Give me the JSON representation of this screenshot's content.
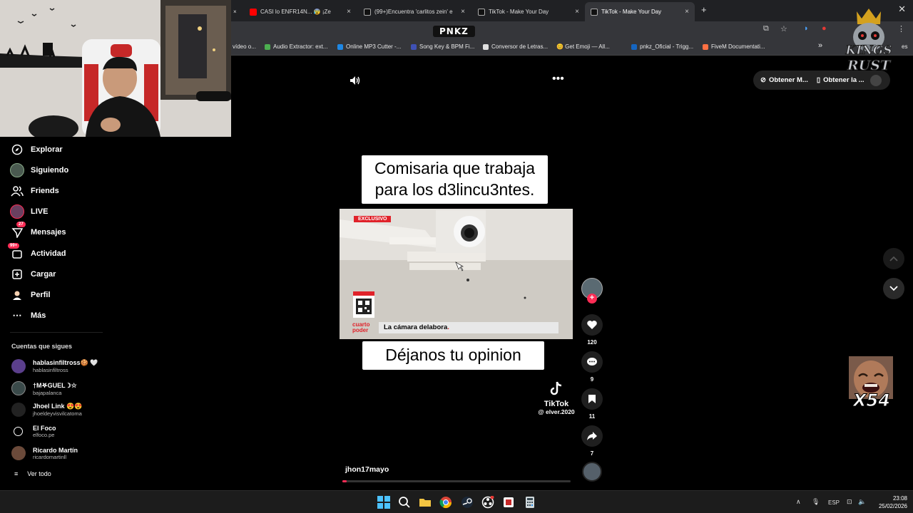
{
  "browser": {
    "tabs": [
      {
        "title": "CASI lo ENFR14N... 😰 ¡Ze",
        "favicon_color": "#ff0000"
      },
      {
        "title": "(99+)Encuentra 'carlitos zein' e",
        "favicon_color": "#222222"
      },
      {
        "title": "TikTok - Make Your Day",
        "favicon_color": "#222222"
      },
      {
        "title": "TikTok - Make Your Day",
        "favicon_color": "#222222"
      }
    ],
    "active_tab_index": 3,
    "tab_close_glyph": "×",
    "new_tab_glyph": "+",
    "window_close_glyph": "✕",
    "logo_text": "PNKZ",
    "bookmarks": [
      {
        "label": "vídeo o...",
        "color": "#888888"
      },
      {
        "label": "Audio Extractor: ext...",
        "color": "#4caf50"
      },
      {
        "label": "Online MP3 Cutter -...",
        "color": "#1e88e5"
      },
      {
        "label": "Song Key & BPM Fi...",
        "color": "#3f51b5"
      },
      {
        "label": "Conversor de Letras...",
        "color": "#e0e0e0"
      },
      {
        "label": "😊 Get Emoji — All...",
        "color": "#f4b400"
      },
      {
        "label": "pnkz_Oficial - Trigg...",
        "color": "#1565c0"
      },
      {
        "label": "FiveM Documentati...",
        "color": "#ff7043"
      }
    ],
    "bookmarks_overflow": "»",
    "bookmarks_tail": "es"
  },
  "sidebar": {
    "nav": [
      {
        "label": "Explorar",
        "icon": "compass-icon"
      },
      {
        "label": "Siguiendo",
        "icon": "avatar-icon"
      },
      {
        "label": "Friends",
        "icon": "friends-icon"
      },
      {
        "label": "LIVE",
        "icon": "live-icon"
      },
      {
        "label": "Mensajes",
        "icon": "messages-icon",
        "badge": "27"
      },
      {
        "label": "Actividad",
        "icon": "activity-icon",
        "badge": "99+"
      },
      {
        "label": "Cargar",
        "icon": "upload-icon"
      },
      {
        "label": "Perfil",
        "icon": "profile-icon"
      },
      {
        "label": "Más",
        "icon": "more-icon"
      }
    ],
    "following_title": "Cuentas que sigues",
    "accounts": [
      {
        "name": "hablasinfiltross🍪 🤍",
        "handle": "hablasinfiltross",
        "avatar_color": "#5b3f8c"
      },
      {
        "name": "†M𖤐GUEL☽☆",
        "handle": "bajapalanca",
        "avatar_color": "#3a4a4a"
      },
      {
        "name": "Jhoel Link 😍😍",
        "handle": "jhoeldeyvisvilcatoma",
        "avatar_color": "#222222"
      },
      {
        "name": "El Foco",
        "handle": "elfoco.pe",
        "avatar_color": "#000000"
      },
      {
        "name": "Ricardo Martín",
        "handle": "ricardomartinll",
        "avatar_color": "#6b4a3a"
      }
    ],
    "see_all": "Ver todo"
  },
  "player": {
    "pills": [
      "Obtener M...",
      "Obtener la ..."
    ],
    "caption_top_line1": "Comisaria que trabaja",
    "caption_top_line2": "para los d3lincu3ntes.",
    "caption_bottom": "Déjanos tu opinion",
    "video_badge": "EXCLUSIVO",
    "video_lower_third": "La cámara delabora",
    "video_brand_line1": "cuarto",
    "video_brand_line2": "poder",
    "watermark_app": "TikTok",
    "watermark_handle": "@ elver.2020",
    "author": "jhon17mayo",
    "progress_fraction": 0.01,
    "actions": [
      {
        "name": "like",
        "count": "120"
      },
      {
        "name": "comment",
        "count": "9"
      },
      {
        "name": "favorite",
        "count": "11"
      },
      {
        "name": "share",
        "count": "7"
      }
    ]
  },
  "overlay": {
    "multiplier": "X54",
    "logo_line1": "KINGS",
    "logo_line2": "RUST"
  },
  "taskbar": {
    "language": "ESP",
    "time": "23:08",
    "date": "25/02/2026"
  }
}
